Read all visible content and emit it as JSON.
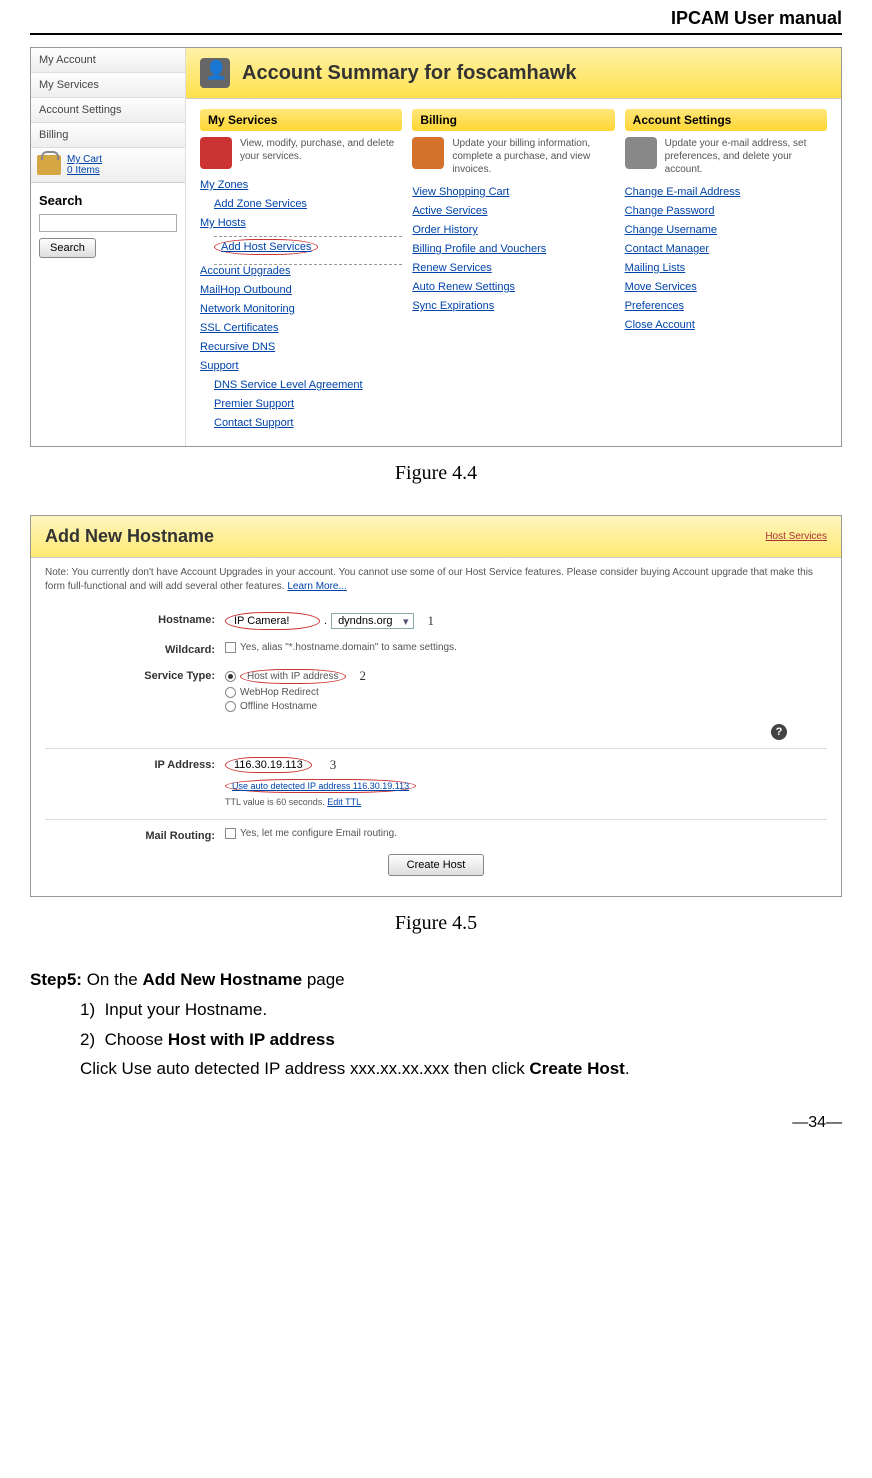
{
  "header": {
    "title": "IPCAM User manual"
  },
  "figure1": {
    "sidebar": {
      "nav": [
        "My Account",
        "My Services",
        "Account Settings",
        "Billing"
      ],
      "cart": {
        "label": "My Cart",
        "count": "0 Items"
      },
      "search": {
        "title": "Search",
        "button": "Search"
      }
    },
    "banner": {
      "title": "Account Summary for foscamhawk"
    },
    "columns": {
      "services": {
        "header": "My Services",
        "desc": "View, modify, purchase, and delete your services.",
        "links": [
          "My Zones",
          "Add Zone Services",
          "My Hosts",
          "Add Host Services",
          "Account Upgrades",
          "MailHop Outbound",
          "Network Monitoring",
          "SSL Certificates",
          "Recursive DNS",
          "Support",
          "DNS Service Level Agreement",
          "Premier Support",
          "Contact Support"
        ]
      },
      "billing": {
        "header": "Billing",
        "desc": "Update your billing information, complete a purchase, and view invoices.",
        "links": [
          "View Shopping Cart",
          "Active Services",
          "Order History",
          "Billing Profile and Vouchers",
          "Renew Services",
          "Auto Renew Settings",
          "Sync Expirations"
        ]
      },
      "account": {
        "header": "Account Settings",
        "desc": "Update your e-mail address, set preferences, and delete your account.",
        "links": [
          "Change E-mail Address",
          "Change Password",
          "Change Username",
          "Contact Manager",
          "Mailing Lists",
          "Move Services",
          "Preferences",
          "Close Account"
        ]
      }
    },
    "caption": "Figure 4.4"
  },
  "figure2": {
    "header": {
      "title": "Add New Hostname",
      "link": "Host Services"
    },
    "note": "Note: You currently don't have Account Upgrades in your account. You cannot use some of our Host Service features. Please consider buying Account upgrade that make this form full-functional and will add several other features.",
    "note_link": "Learn More...",
    "form": {
      "hostname": {
        "label": "Hostname:",
        "value": "IP Camera!",
        "domain": "dyndns.org",
        "annotation": "1"
      },
      "wildcard": {
        "label": "Wildcard:",
        "text": "Yes, alias \"*.hostname.domain\" to same settings."
      },
      "servicetype": {
        "label": "Service Type:",
        "options": [
          "Host with IP address",
          "WebHop Redirect",
          "Offline Hostname"
        ],
        "annotation": "2"
      },
      "ipaddress": {
        "label": "IP Address:",
        "value": "116.30.19.113",
        "auto_detect": "Use auto detected IP address 116.30.19.113",
        "ttl": "TTL value is 60 seconds.",
        "ttl_link": "Edit TTL",
        "annotation": "3"
      },
      "mailrouting": {
        "label": "Mail Routing:",
        "text": "Yes, let me configure Email routing."
      },
      "button": "Create Host"
    },
    "caption": "Figure 4.5"
  },
  "instructions": {
    "step_label": "Step5:",
    "step_text": " On the ",
    "step_bold": "Add New Hostname",
    "step_text2": " page",
    "item1_num": "1)",
    "item1_text": "Input your Hostname.",
    "item2_num": "2)",
    "item2_text_pre": "Choose ",
    "item2_bold": "Host with IP address",
    "note_pre": "Click Use auto detected IP address xxx.xx.xx.xxx then click ",
    "note_bold": "Create Host",
    "note_post": "."
  },
  "footer": {
    "page": "—34—"
  }
}
